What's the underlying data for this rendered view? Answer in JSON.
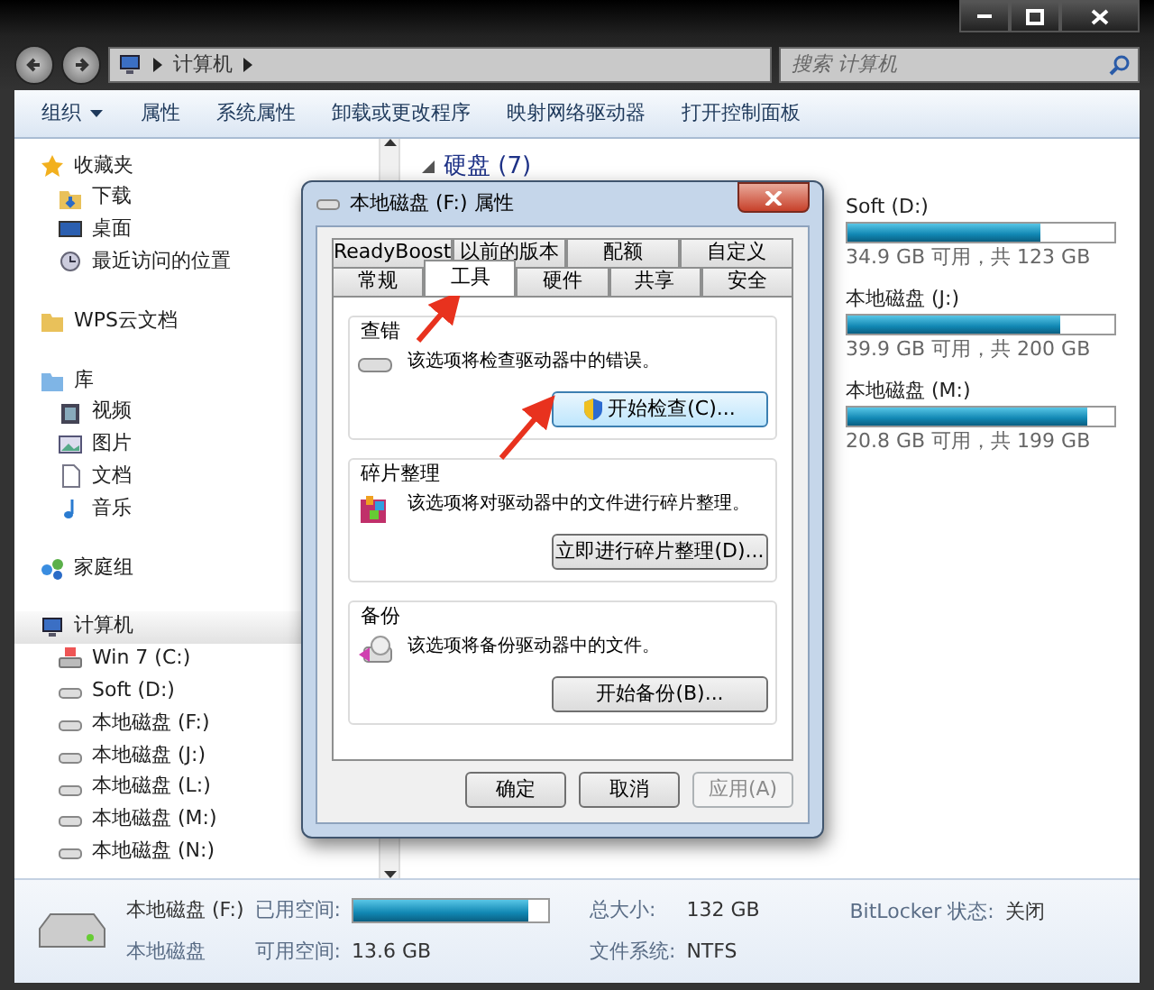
{
  "address_bar": {
    "path": [
      "计算机"
    ],
    "search_placeholder": "搜索 计算机"
  },
  "toolbar": [
    {
      "label": "组织",
      "dropdown": true
    },
    {
      "label": "属性",
      "dropdown": false
    },
    {
      "label": "系统属性",
      "dropdown": false
    },
    {
      "label": "卸载或更改程序",
      "dropdown": false
    },
    {
      "label": "映射网络驱动器",
      "dropdown": false
    },
    {
      "label": "打开控制面板",
      "dropdown": false
    }
  ],
  "sidebar": {
    "groups": [
      {
        "label": "收藏夹",
        "selected": false,
        "children": [
          {
            "label": "下载"
          },
          {
            "label": "桌面"
          },
          {
            "label": "最近访问的位置"
          }
        ]
      },
      {
        "label": "WPS云文档",
        "selected": false
      },
      {
        "label": "库",
        "selected": false,
        "children": [
          {
            "label": "视频"
          },
          {
            "label": "图片"
          },
          {
            "label": "文档"
          },
          {
            "label": "音乐"
          }
        ]
      },
      {
        "label": "家庭组",
        "selected": false
      },
      {
        "label": "计算机",
        "selected": true,
        "children": [
          {
            "label": "Win 7 (C:)"
          },
          {
            "label": "Soft (D:)"
          },
          {
            "label": "本地磁盘 (F:)"
          },
          {
            "label": "本地磁盘 (J:)"
          },
          {
            "label": "本地磁盘 (L:)"
          },
          {
            "label": "本地磁盘 (M:)"
          },
          {
            "label": "本地磁盘 (N:)"
          }
        ]
      }
    ]
  },
  "content": {
    "group_title": "硬盘 (7)",
    "drives": [
      {
        "name": "Soft (D:)",
        "level": 0.72,
        "reading": "34.9 GB 可用，共 123 GB"
      },
      {
        "name": "本地磁盘 (J:)",
        "level": 0.8,
        "reading": "39.9 GB 可用，共 200 GB"
      },
      {
        "name": "本地磁盘 (M:)",
        "level": 0.9,
        "reading": "20.8 GB 可用，共 199 GB"
      }
    ]
  },
  "dialog": {
    "title": "本地磁盘 (F:) 属性",
    "tab_rows": [
      [
        {
          "label": "ReadyBoost",
          "selected": false
        },
        {
          "label": "以前的版本",
          "selected": false
        },
        {
          "label": "配额",
          "selected": false
        },
        {
          "label": "自定义",
          "selected": false
        }
      ],
      [
        {
          "label": "常规",
          "selected": false
        },
        {
          "label": "工具",
          "selected": true
        },
        {
          "label": "硬件",
          "selected": false
        },
        {
          "label": "共享",
          "selected": false
        },
        {
          "label": "安全",
          "selected": false
        }
      ]
    ],
    "sections": [
      {
        "kind": "check",
        "title": "查错",
        "text": "该选项将检查驱动器中的错误。",
        "button": "开始检查(C)...",
        "shield": true
      },
      {
        "kind": "defrag",
        "title": "碎片整理",
        "text": "该选项将对驱动器中的文件进行碎片整理。",
        "button": "立即进行碎片整理(D)...",
        "shield": false
      },
      {
        "kind": "backup",
        "title": "备份",
        "text": "该选项将备份驱动器中的文件。",
        "button": "开始备份(B)...",
        "shield": false
      }
    ],
    "buttons": [
      {
        "label": "确定",
        "disabled": false
      },
      {
        "label": "取消",
        "disabled": false
      },
      {
        "label": "应用(A)",
        "disabled": true
      }
    ]
  },
  "details": {
    "name": "本地磁盘 (F:)",
    "type": "本地磁盘",
    "used_label": "已用空间:",
    "level": 0.9,
    "free_label": "可用空间:",
    "free": "13.6 GB",
    "total_label": "总大小:",
    "total": "132 GB",
    "fs_label": "文件系统:",
    "fs": "NTFS",
    "bitlocker_label": "BitLocker 状态:",
    "bitlocker": "关闭"
  }
}
